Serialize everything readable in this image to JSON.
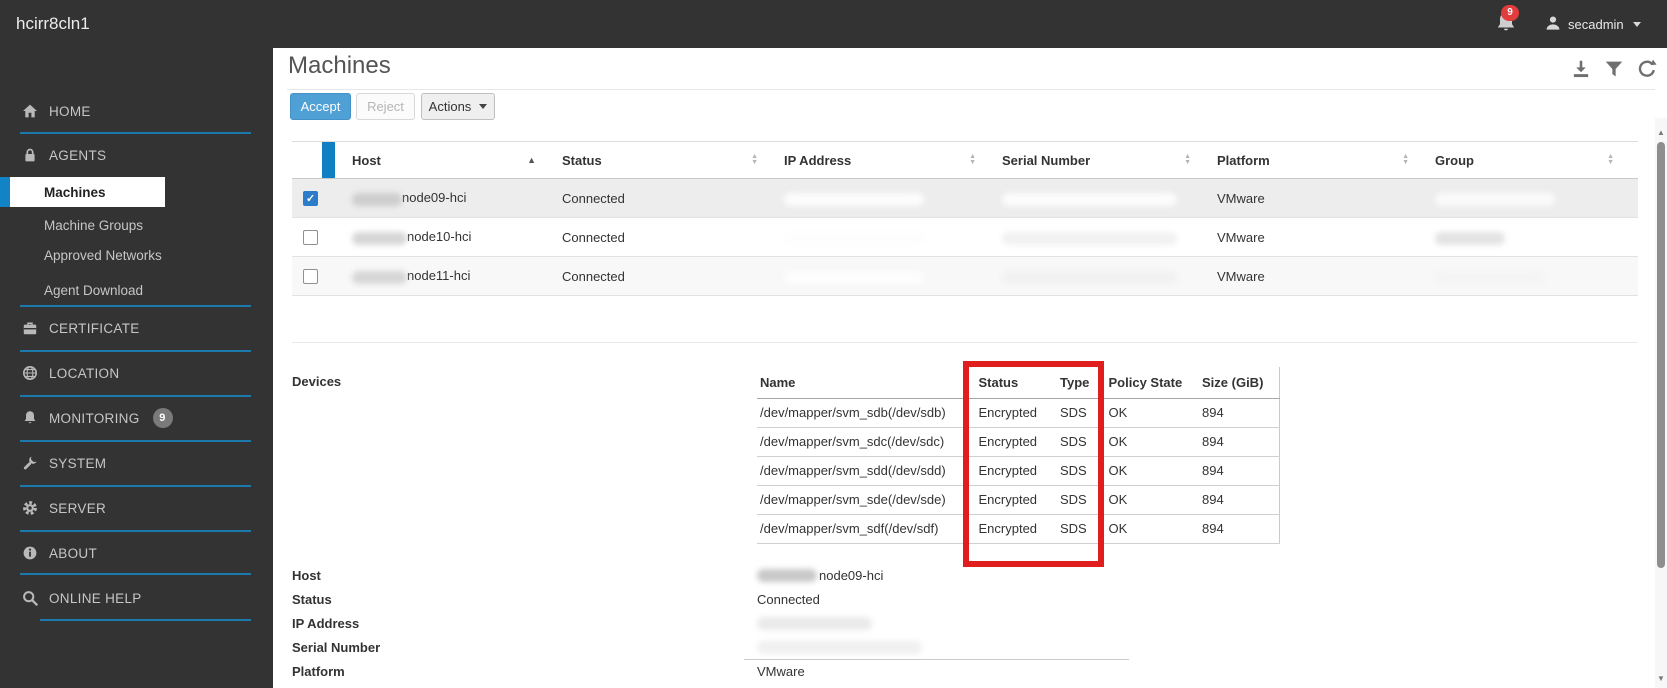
{
  "topbar": {
    "brand": "hcirr8cln1",
    "notification_count": "9",
    "username": "secadmin"
  },
  "sidebar": {
    "items": [
      {
        "label": "HOME",
        "icon": "home"
      },
      {
        "label": "AGENTS",
        "icon": "lock"
      },
      {
        "label": "CERTIFICATE",
        "icon": "certificate"
      },
      {
        "label": "LOCATION",
        "icon": "globe"
      },
      {
        "label": "MONITORING",
        "icon": "bell",
        "badge": "9"
      },
      {
        "label": "SYSTEM",
        "icon": "wrench"
      },
      {
        "label": "SERVER",
        "icon": "gear"
      },
      {
        "label": "ABOUT",
        "icon": "info"
      },
      {
        "label": "ONLINE HELP",
        "icon": "search"
      }
    ],
    "agents_submenu": [
      {
        "label": "Machines",
        "active": true
      },
      {
        "label": "Machine Groups"
      },
      {
        "label": "Approved Networks"
      },
      {
        "label": "Agent Download"
      }
    ]
  },
  "main": {
    "title": "Machines",
    "toolbar": {
      "accept_label": "Accept",
      "reject_label": "Reject",
      "actions_label": "Actions"
    },
    "machines_table": {
      "columns": [
        {
          "label": "Host",
          "sorted": "asc"
        },
        {
          "label": "Status"
        },
        {
          "label": "IP Address"
        },
        {
          "label": "Serial Number"
        },
        {
          "label": "Platform"
        },
        {
          "label": "Group"
        }
      ],
      "rows": [
        {
          "host": "node09-hci",
          "status": "Connected",
          "platform": "VMware",
          "selected": true
        },
        {
          "host": "node10-hci",
          "status": "Connected",
          "platform": "VMware",
          "selected": false
        },
        {
          "host": "node11-hci",
          "status": "Connected",
          "platform": "VMware",
          "selected": false
        }
      ]
    },
    "devices": {
      "label": "Devices",
      "columns": [
        "Name",
        "Status",
        "Type",
        "Policy State",
        "Size (GiB)"
      ],
      "rows": [
        {
          "name": "/dev/mapper/svm_sdb(/dev/sdb)",
          "status": "Encrypted",
          "type": "SDS",
          "policy_state": "OK",
          "size": "894"
        },
        {
          "name": "/dev/mapper/svm_sdc(/dev/sdc)",
          "status": "Encrypted",
          "type": "SDS",
          "policy_state": "OK",
          "size": "894"
        },
        {
          "name": "/dev/mapper/svm_sdd(/dev/sdd)",
          "status": "Encrypted",
          "type": "SDS",
          "policy_state": "OK",
          "size": "894"
        },
        {
          "name": "/dev/mapper/svm_sde(/dev/sde)",
          "status": "Encrypted",
          "type": "SDS",
          "policy_state": "OK",
          "size": "894"
        },
        {
          "name": "/dev/mapper/svm_sdf(/dev/sdf)",
          "status": "Encrypted",
          "type": "SDS",
          "policy_state": "OK",
          "size": "894"
        }
      ]
    },
    "details": {
      "host_label": "Host",
      "host_value": "node09-hci",
      "status_label": "Status",
      "status_value": "Connected",
      "ip_label": "IP Address",
      "serial_label": "Serial Number",
      "platform_label": "Platform",
      "platform_value": "VMware"
    },
    "annotation": {
      "type": "highlight-box",
      "color": "#e01e1e",
      "around": "Status and Type columns of Devices table"
    }
  },
  "colors": {
    "accent_blue": "#1c79ad",
    "accept_button": "#4fa0d5",
    "annotation_red": "#e01e1e",
    "badge_red": "#e23c3c"
  }
}
